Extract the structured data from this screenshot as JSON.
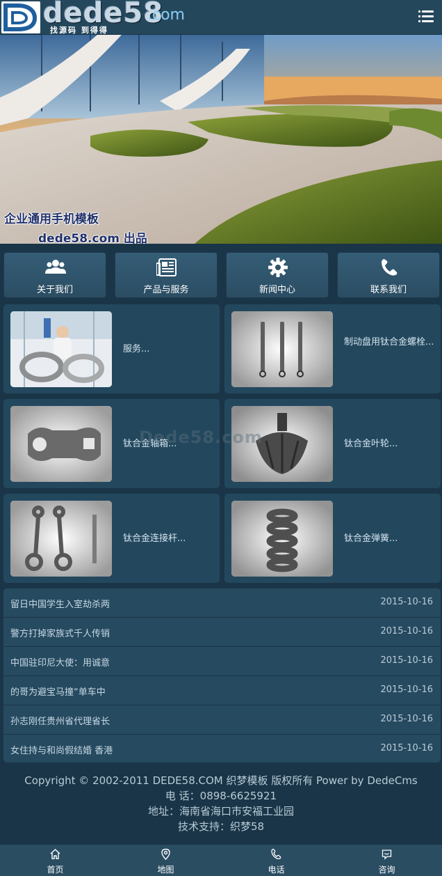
{
  "header": {
    "logo_text": "dede58",
    "logo_com": ".com",
    "logo_sub": "找源码 到得得",
    "menu_icon": "list-icon"
  },
  "banner": {
    "caption_line1": "企业通用手机模板",
    "caption_line2": "dede58.com 出品"
  },
  "nav": {
    "items": [
      {
        "label": "关于我们",
        "icon": "users-icon"
      },
      {
        "label": "产品与服务",
        "icon": "newspaper-icon"
      },
      {
        "label": "新闻中心",
        "icon": "gear-icon"
      },
      {
        "label": "联系我们",
        "icon": "phone-icon"
      }
    ]
  },
  "products": [
    {
      "title": "服务..."
    },
    {
      "title": "制动盘用钛合金螺栓..."
    },
    {
      "title": "钛合金轴箱..."
    },
    {
      "title": "钛合金叶轮..."
    },
    {
      "title": "钛合金连接杆..."
    },
    {
      "title": "钛合金弹簧..."
    }
  ],
  "watermark": "Dede58.com",
  "news": [
    {
      "title": "留日中国学生入室劫杀两",
      "date": "2015-10-16"
    },
    {
      "title": "警方打掉家族式千人传销",
      "date": "2015-10-16"
    },
    {
      "title": "中国驻印尼大使：用诚意",
      "date": "2015-10-16"
    },
    {
      "title": "的哥为避宝马撞“单车中",
      "date": "2015-10-16"
    },
    {
      "title": "孙志刚任贵州省代理省长",
      "date": "2015-10-16"
    },
    {
      "title": "女住持与和尚假结婚 香港",
      "date": "2015-10-16"
    }
  ],
  "footer": {
    "copyright": "Copyright © 2002-2011 DEDE58.COM 织梦模板 版权所有 Power by DedeCms",
    "phone": "电 话：0898-6625921",
    "address": "地址：海南省海口市安福工业园",
    "support": "技术支持：织梦58"
  },
  "tabbar": [
    {
      "label": "首页",
      "icon": "home-icon"
    },
    {
      "label": "地图",
      "icon": "map-pin-icon"
    },
    {
      "label": "电话",
      "icon": "phone-icon"
    },
    {
      "label": "咨询",
      "icon": "chat-icon"
    }
  ]
}
